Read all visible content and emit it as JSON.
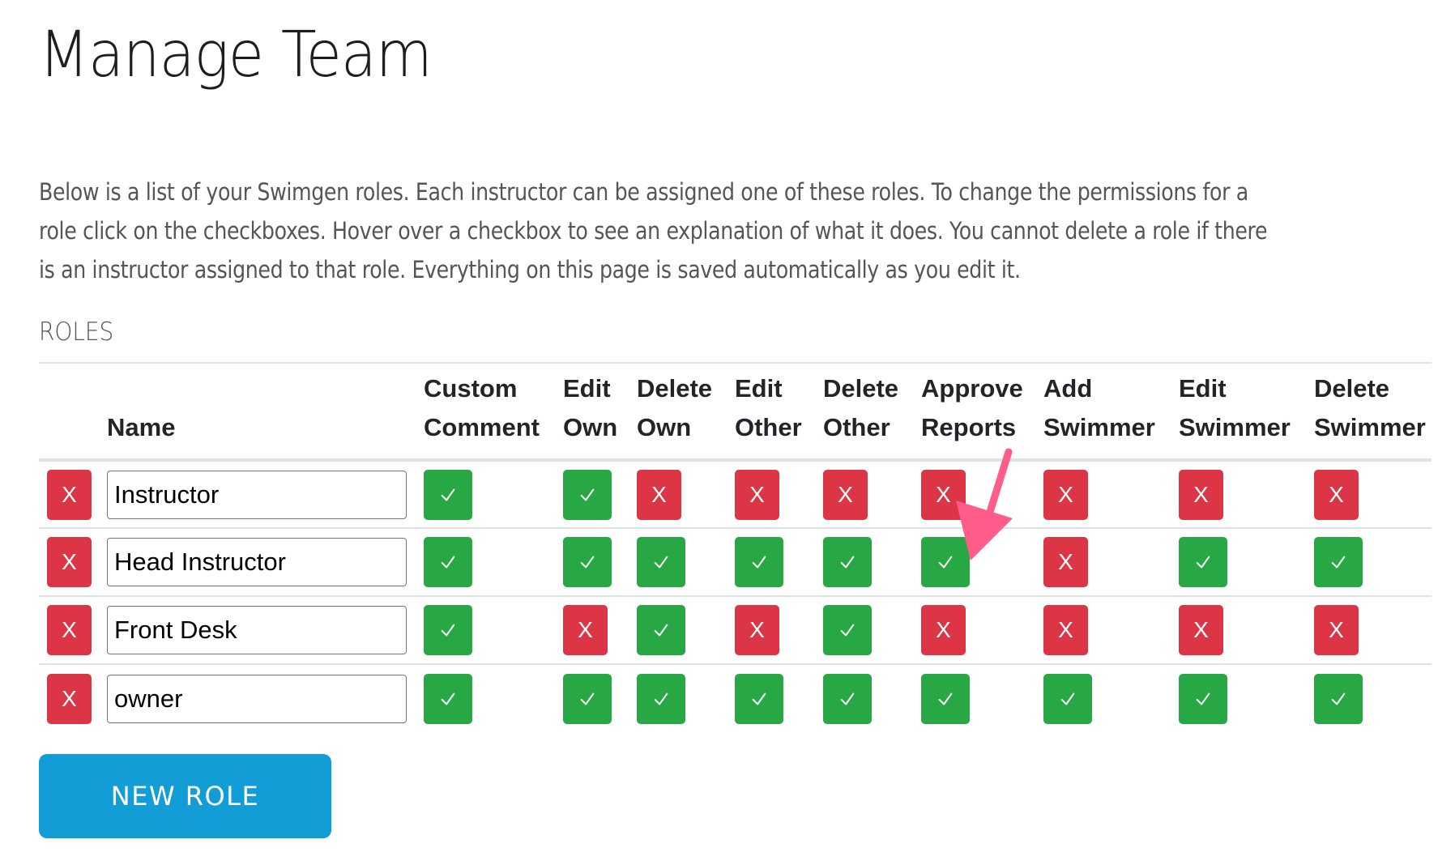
{
  "page": {
    "title": "Manage Team",
    "intro": "Below is a list of your Swimgen roles. Each instructor can be assigned one of these roles. To change the permissions for a role click on the checkboxes. Hover over a checkbox to see an explanation of what it does. You cannot delete a role if there is an instructor assigned to that role. Everything on this page is saved automatically as you edit it.",
    "section_label": "ROLES"
  },
  "table": {
    "name_header": "Name",
    "permission_columns": [
      {
        "key": "custom_comment",
        "line1": "Custom",
        "line2": "Comment"
      },
      {
        "key": "edit_own",
        "line1": "Edit",
        "line2": "Own"
      },
      {
        "key": "delete_own",
        "line1": "Delete",
        "line2": "Own"
      },
      {
        "key": "edit_other",
        "line1": "Edit",
        "line2": "Other"
      },
      {
        "key": "delete_other",
        "line1": "Delete",
        "line2": "Other"
      },
      {
        "key": "approve_reports",
        "line1": "Approve",
        "line2": "Reports"
      },
      {
        "key": "add_swimmer",
        "line1": "Add",
        "line2": "Swimmer"
      },
      {
        "key": "edit_swimmer",
        "line1": "Edit",
        "line2": "Swimmer"
      },
      {
        "key": "delete_swimmer",
        "line1": "Delete",
        "line2": "Swimmer"
      }
    ],
    "delete_role_label": "X",
    "enabled_glyph": "check-icon",
    "disabled_label": "X",
    "roles": [
      {
        "name": "Instructor",
        "permissions": [
          true,
          true,
          false,
          false,
          false,
          false,
          false,
          false,
          false
        ]
      },
      {
        "name": "Head Instructor",
        "permissions": [
          true,
          true,
          true,
          true,
          true,
          true,
          false,
          true,
          true
        ]
      },
      {
        "name": "Front Desk",
        "permissions": [
          true,
          false,
          true,
          false,
          true,
          false,
          false,
          false,
          false
        ]
      },
      {
        "name": "owner",
        "permissions": [
          true,
          true,
          true,
          true,
          true,
          true,
          true,
          true,
          true
        ]
      }
    ]
  },
  "new_role_button": "NEW ROLE",
  "annotation": {
    "type": "arrow",
    "color": "#ff5c8a",
    "points_to": "Head Instructor / Approve Reports"
  },
  "colors": {
    "enabled": "#28a745",
    "disabled": "#dc3545",
    "primary_button": "#129dd6"
  }
}
